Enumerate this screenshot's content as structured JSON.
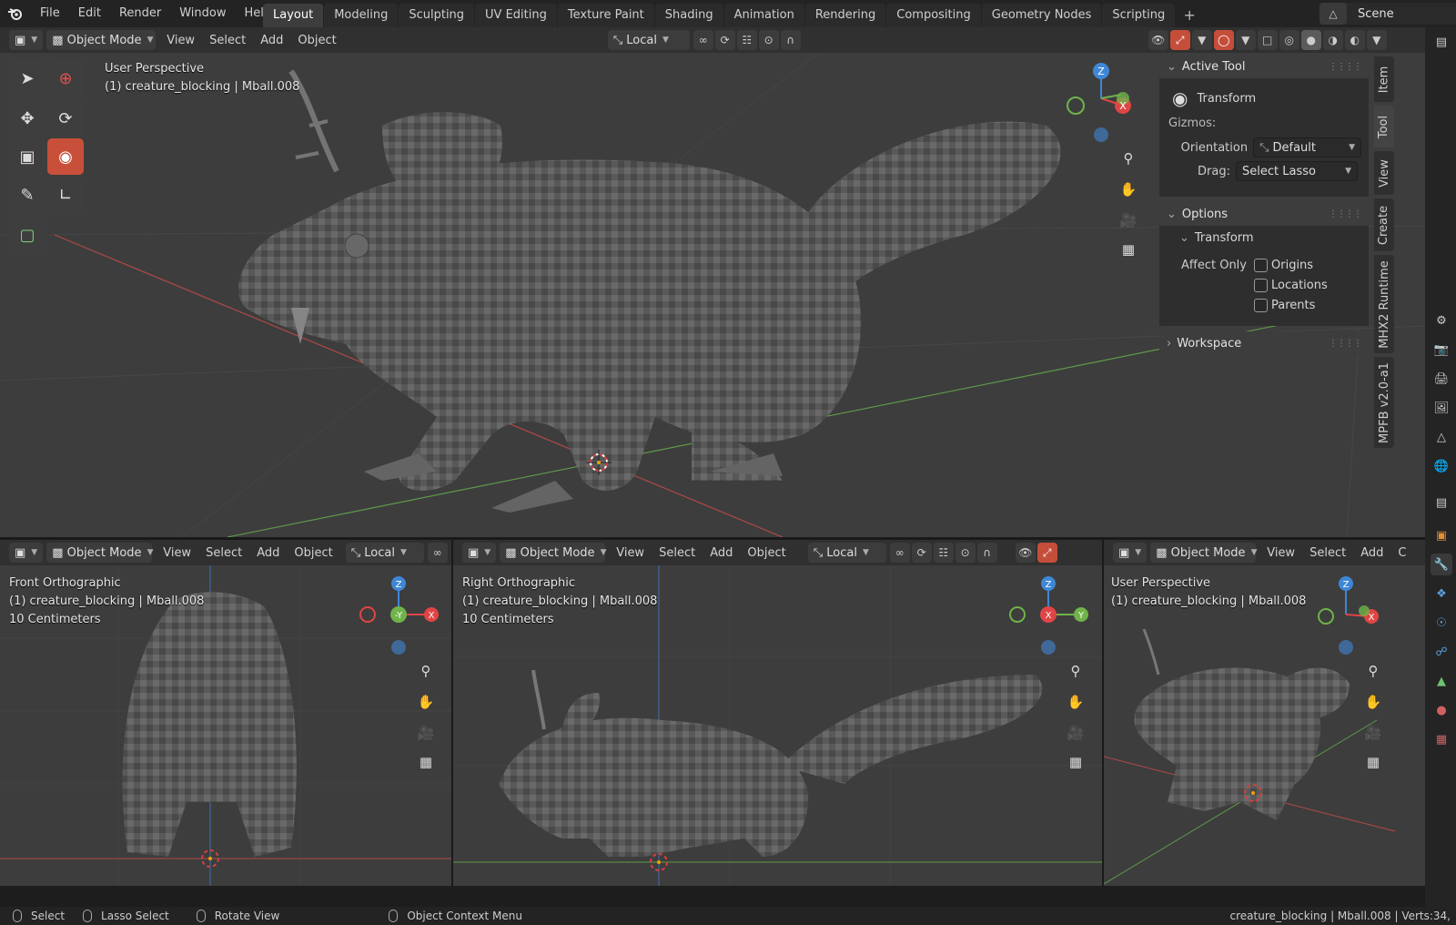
{
  "topbar": {
    "menus": [
      "File",
      "Edit",
      "Render",
      "Window",
      "Help"
    ],
    "workspaces": [
      {
        "label": "Layout",
        "active": true
      },
      {
        "label": "Modeling",
        "active": false
      },
      {
        "label": "Sculpting",
        "active": false
      },
      {
        "label": "UV Editing",
        "active": false
      },
      {
        "label": "Texture Paint",
        "active": false
      },
      {
        "label": "Shading",
        "active": false
      },
      {
        "label": "Animation",
        "active": false
      },
      {
        "label": "Rendering",
        "active": false
      },
      {
        "label": "Compositing",
        "active": false
      },
      {
        "label": "Geometry Nodes",
        "active": false
      },
      {
        "label": "Scripting",
        "active": false
      }
    ],
    "add_tab": "+",
    "scene": "Scene"
  },
  "main_header": {
    "mode": "Object Mode",
    "menus": [
      "View",
      "Select",
      "Add",
      "Object"
    ],
    "orientation": "Local"
  },
  "main_view": {
    "view_name": "User Perspective",
    "object_info": "(1) creature_blocking | Mball.008"
  },
  "npanel": {
    "active_tool_title": "Active Tool",
    "tool_name": "Transform",
    "gizmos_label": "Gizmos:",
    "orientation_label": "Orientation",
    "orientation_value": "Default",
    "drag_label": "Drag:",
    "drag_value": "Select Lasso",
    "options_title": "Options",
    "transform_title": "Transform",
    "affect_only_label": "Affect Only",
    "affect_options": [
      "Origins",
      "Locations",
      "Parents"
    ],
    "workspace_title": "Workspace",
    "tabs": [
      "Item",
      "Tool",
      "View",
      "Create",
      "MHX2 Runtime",
      "MPFB v2.0-a1"
    ]
  },
  "gizmo_axes": {
    "z": "Z",
    "x": "X",
    "y": "Y",
    "neg_y": "-Y"
  },
  "bottom_left": {
    "mode": "Object Mode",
    "menus": [
      "View",
      "Select",
      "Add",
      "Object"
    ],
    "orientation": "Local",
    "view_name": "Front Orthographic",
    "object_info": "(1) creature_blocking | Mball.008",
    "scale": "10 Centimeters"
  },
  "bottom_mid": {
    "mode": "Object Mode",
    "menus": [
      "View",
      "Select",
      "Add",
      "Object"
    ],
    "orientation": "Local",
    "view_name": "Right Orthographic",
    "object_info": "(1) creature_blocking | Mball.008",
    "scale": "10 Centimeters"
  },
  "bottom_right": {
    "mode": "Object Mode",
    "menus": [
      "View",
      "Select",
      "Add"
    ],
    "menu_clip": "C",
    "view_name": "User Perspective",
    "object_info": "(1) creature_blocking | Mball.008"
  },
  "statusbar": {
    "select": "Select",
    "lasso": "Lasso Select",
    "rotate": "Rotate View",
    "context": "Object Context Menu",
    "info": "creature_blocking | Mball.008 | Verts:34,"
  },
  "colors": {
    "accent_active": "#c8503a",
    "axis_x": "#e04545",
    "axis_y": "#6fb34a",
    "axis_z": "#3f87d6",
    "viewport_bg": "#3d3d3d"
  }
}
